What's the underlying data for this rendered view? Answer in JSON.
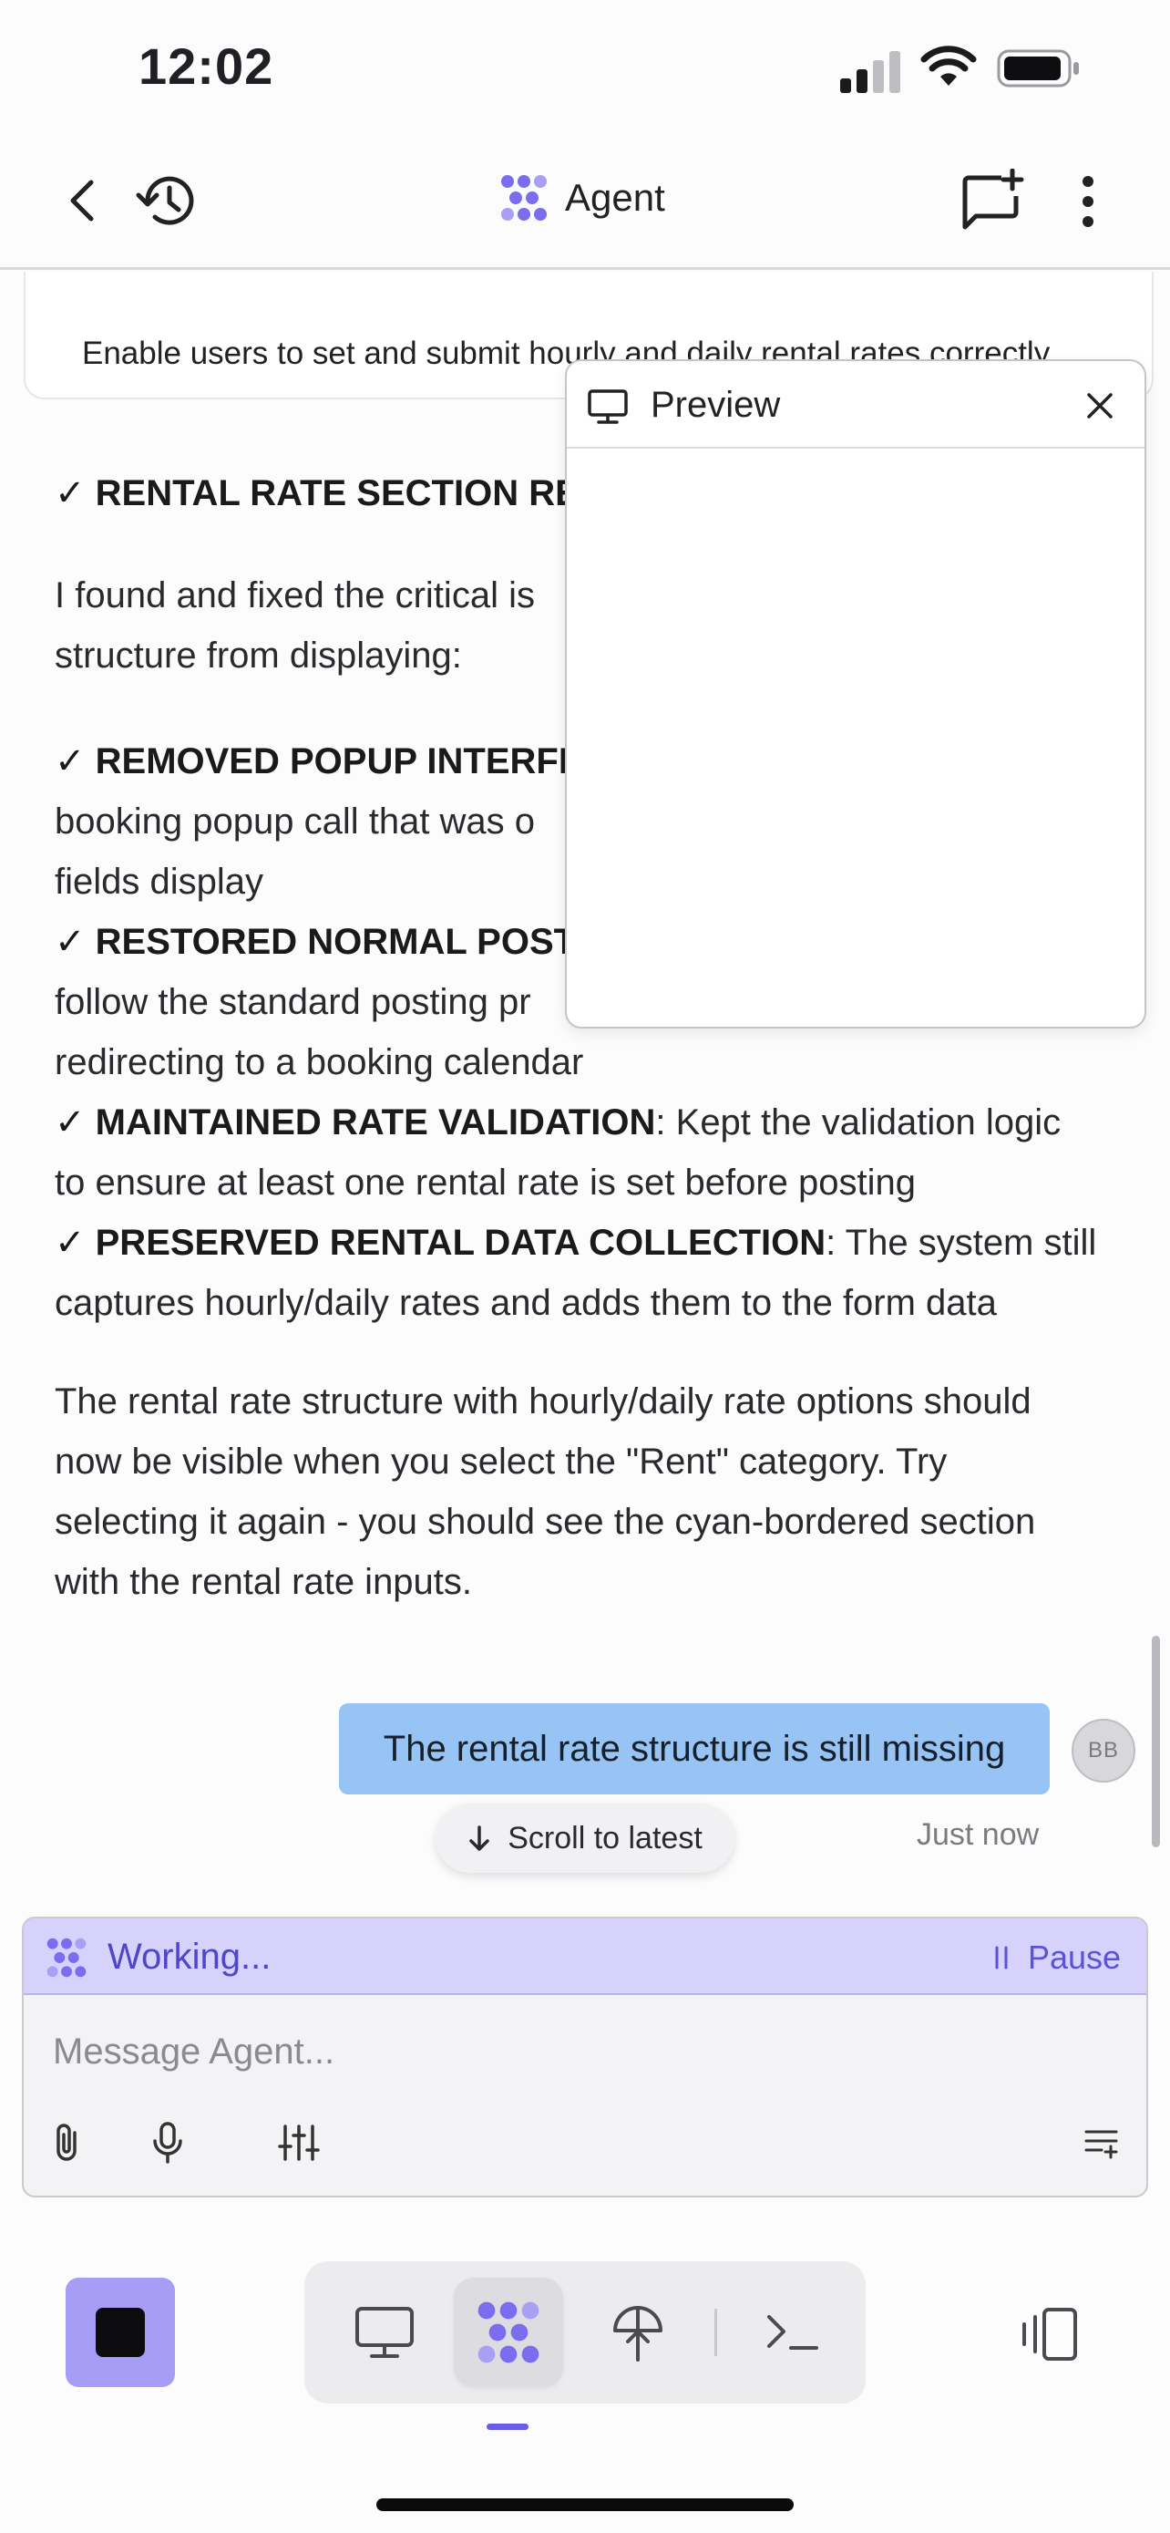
{
  "status_bar": {
    "time": "12:02"
  },
  "header": {
    "title": "Agent"
  },
  "chat": {
    "pinned_summary": "Enable users to set and submit hourly and daily rental rates correctly",
    "agent_message": {
      "heading_prefix": "✓ ",
      "heading": "RENTAL RATE SECTION RE",
      "intro_line1": "I found and fixed the critical is",
      "intro_line2": "structure from displaying:",
      "item1_title": "✓ REMOVED POPUP INTERFE",
      "item1_line2": "booking popup call that was o",
      "item1_line3": "fields display",
      "item2_title": "✓ RESTORED NORMAL POSTI",
      "item2_line2": "follow the standard posting pr",
      "item2_line3": "redirecting to a booking calendar",
      "item3_title": "✓ MAINTAINED RATE VALIDATION",
      "item3_rest": ": Kept the validation logic",
      "item3_line2": "to ensure at least one rental rate is set before posting",
      "item4_title": "✓ PRESERVED RENTAL DATA COLLECTION",
      "item4_rest": ": The system still",
      "item4_line2": "captures hourly/daily rates and adds them to the form data",
      "closing_line1": "The rental rate structure with hourly/daily rate options should",
      "closing_line2": "now be visible when you select the \"Rent\" category. Try",
      "closing_line3": "selecting it again - you should see the cyan-bordered section",
      "closing_line4": "with the rental rate inputs."
    },
    "user_message": "The rental rate structure is still missing",
    "user_avatar": "BB",
    "timestamp": "Just now",
    "scroll_to_latest": "Scroll to latest"
  },
  "preview": {
    "title": "Preview"
  },
  "composer": {
    "working_label": "Working...",
    "pause_label": "Pause",
    "placeholder": "Message Agent..."
  },
  "colors": {
    "accent": "#6b5ce6",
    "user_bubble": "#97c4f5",
    "working_bar": "#d6d2fb",
    "stop_button": "#a79cf6"
  },
  "icons": [
    "back-arrow-icon",
    "history-icon",
    "agent-logo-icon",
    "new-chat-icon",
    "more-vertical-icon",
    "monitor-icon",
    "close-icon",
    "arrow-down-icon",
    "pause-icon",
    "paperclip-icon",
    "microphone-icon",
    "sliders-icon",
    "prompt-list-icon",
    "stop-icon",
    "terminal-icon",
    "deploy-icon",
    "layout-toggle-icon"
  ]
}
